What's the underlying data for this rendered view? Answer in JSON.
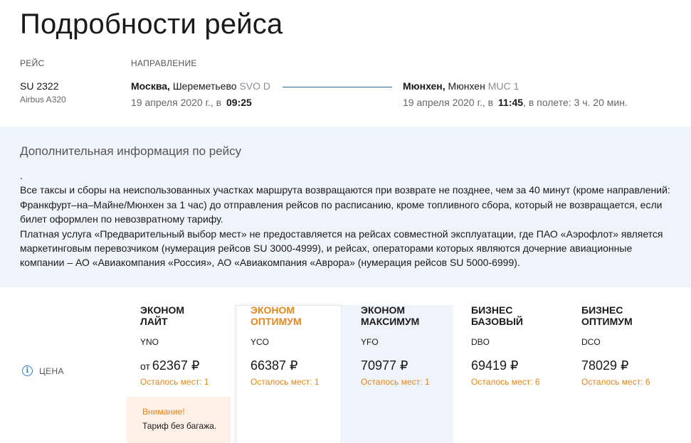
{
  "page_title": "Подробности рейса",
  "flight": {
    "label": "РЕЙС",
    "number": "SU 2322",
    "aircraft": "Airbus A320"
  },
  "direction": {
    "label": "НАПРАВЛЕНИЕ",
    "departure": {
      "city": "Москва,",
      "airport": "Шереметьево",
      "code": "SVO D",
      "date": "19 апреля 2020 г., в",
      "time": "09:25"
    },
    "arrival": {
      "city": "Мюнхен,",
      "airport": "Мюнхен",
      "code": "MUC 1",
      "date": "19 апреля 2020 г., в",
      "time": "11:45",
      "duration": ", в полете: 3 ч. 20 мин."
    },
    "line_color": "#2f6b8f"
  },
  "info": {
    "title": "Дополнительная информация по рейсу",
    "lines": [
      ".",
      "Все таксы и сборы на неиспользованных участках маршрута возвращаются при возврате не позднее, чем за 40 минут (кроме направлений: Франкфурт–на–Майне/Мюнхен за 1 час) до отправления рейсов по расписанию, кроме топливного сбора, который не возвращается, если билет оформлен по невозвратному тарифу.",
      "Платная услуга «Предварительный выбор мест» не предоставляется на рейсах совместной эксплуатации, где ПАО «Аэрофлот» является маркетинговым перевозчиком (нумерация рейсов SU 3000-4999), и рейсах, операторами которых являются дочерние авиационные компании – АО «Авиакомпания «Россия», АО «Авиакомпания «Аврора» (нумерация рейсов SU 5000-6999)."
    ]
  },
  "price_row": {
    "icon": "info-icon",
    "label": "ЦЕНА"
  },
  "fares": [
    {
      "name_line1": "ЭКОНОМ",
      "name_line2": "ЛАЙТ",
      "code": "YNO",
      "price_prefix": "от",
      "price": "62367 ₽",
      "seats": "Осталось мест: 1"
    },
    {
      "name_line1": "ЭКОНОМ",
      "name_line2": "ОПТИМУМ",
      "code": "YCO",
      "price_prefix": "",
      "price": "66387 ₽",
      "seats": "Осталось мест: 1"
    },
    {
      "name_line1": "ЭКОНОМ",
      "name_line2": "МАКСИМУМ",
      "code": "YFO",
      "price_prefix": "",
      "price": "70977 ₽",
      "seats": "Осталось мест: 1"
    },
    {
      "name_line1": "БИЗНЕС",
      "name_line2": "БАЗОВЫЙ",
      "code": "DBO",
      "price_prefix": "",
      "price": "69419 ₽",
      "seats": "Осталось мест: 6"
    },
    {
      "name_line1": "БИЗНЕС",
      "name_line2": "ОПТИМУМ",
      "code": "DCO",
      "price_prefix": "",
      "price": "78029 ₽",
      "seats": "Осталось мест: 6"
    }
  ],
  "warning": {
    "title": "Внимание!",
    "text": "Тариф без багажа."
  },
  "colors": {
    "accent_orange": "#e5861c",
    "info_blue": "#2d7fd6",
    "panel_bg": "#eef4fa"
  }
}
